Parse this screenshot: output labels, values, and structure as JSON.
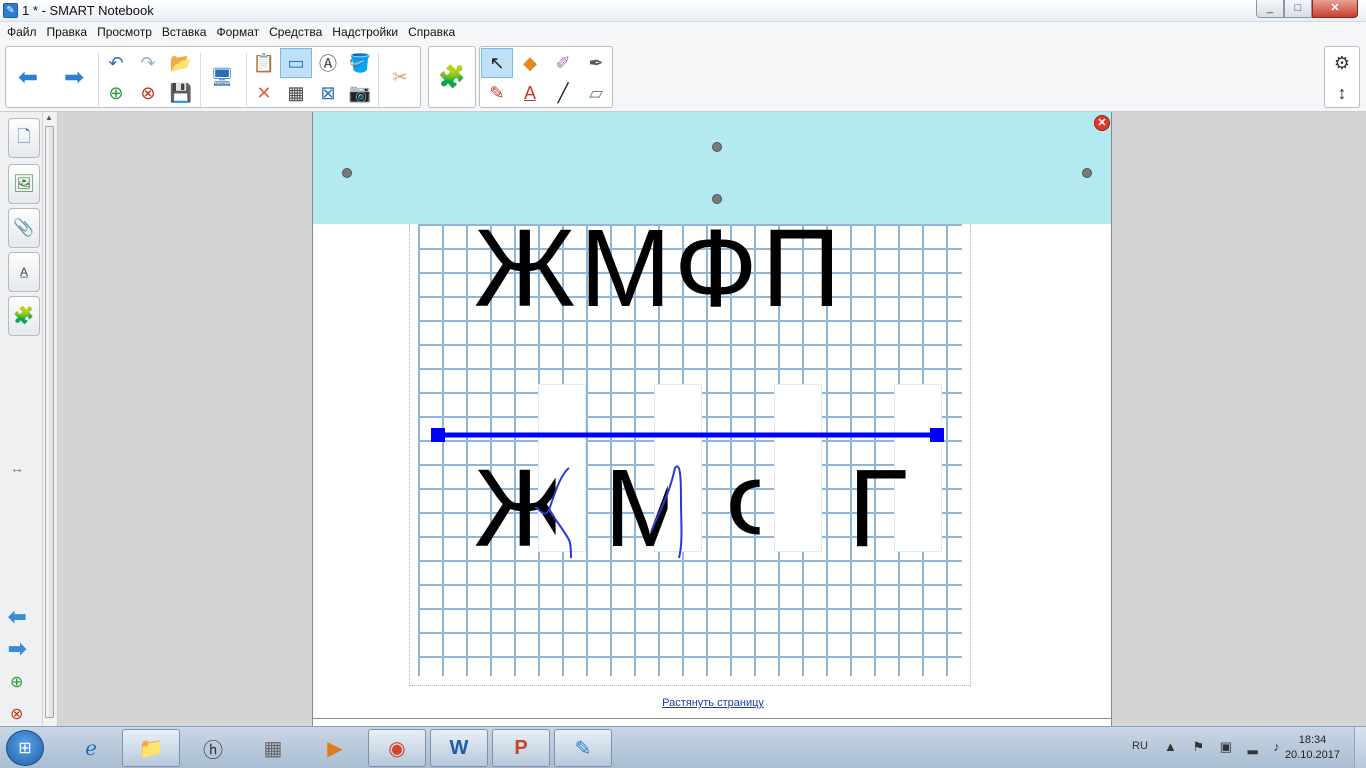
{
  "window": {
    "title": "1 * - SMART Notebook",
    "controls": [
      "_",
      "□",
      "✕"
    ]
  },
  "menu": [
    "Файл",
    "Правка",
    "Просмотр",
    "Вставка",
    "Формат",
    "Средства",
    "Надстройки",
    "Справка"
  ],
  "toolbar": {
    "icons": [
      "back-icon",
      "forward-icon",
      "undo-icon",
      "redo-icon",
      "add-page-icon",
      "delete-page-icon",
      "open-file-icon",
      "save-icon",
      "display-icon",
      "paste-icon",
      "delete-icon",
      "screen-shade-icon",
      "table-icon",
      "full-screen-icon",
      "recognize-icon",
      "screen-capture-icon",
      "fill-icon",
      "cut-icon",
      "addons-icon",
      "select-icon",
      "pens-icon",
      "shapes-icon",
      "text-icon",
      "creative-pen-icon",
      "lines-icon",
      "magic-pen-icon",
      "eraser-icon",
      "settings-icon",
      "move-toolbar-icon"
    ]
  },
  "sidebar": {
    "tabs": [
      "page-sorter-icon",
      "gallery-icon",
      "attachments-icon",
      "properties-icon",
      "addons-icon"
    ],
    "nav": [
      "previous-page-icon",
      "next-page-icon",
      "add-page-icon",
      "delete-page-icon"
    ]
  },
  "page": {
    "top_letters": "ЖМФП",
    "bottom_letters": [
      "Ж",
      "М",
      "Ф",
      "Г"
    ],
    "stretch_link": "Растянуть страницу",
    "line_color": "#0000ff",
    "shade_color": "#b2eaf0"
  },
  "taskbar": {
    "apps": [
      "windows-explorer-icon",
      "internet-explorer-icon",
      "file-manager-icon",
      "hp-icon",
      "calculator-icon",
      "media-player-icon",
      "chrome-icon",
      "word-icon",
      "powerpoint-icon",
      "smart-notebook-icon"
    ],
    "language": "RU",
    "time": "18:34",
    "date": "20.10.2017"
  }
}
